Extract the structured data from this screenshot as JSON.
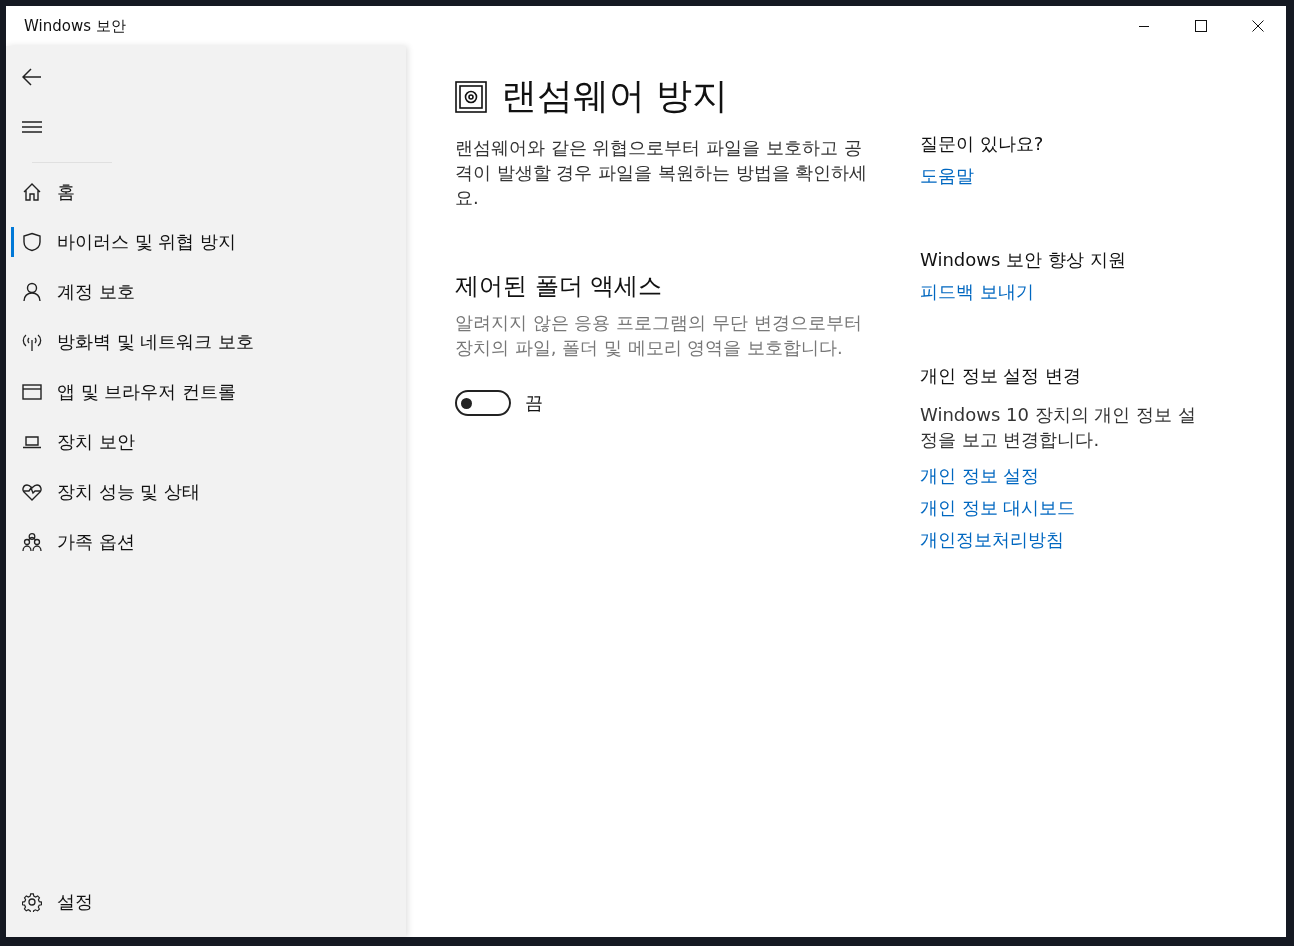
{
  "window": {
    "title": "Windows 보안"
  },
  "sidebar": {
    "items": [
      {
        "kind": "home",
        "label": "홈",
        "selected": false
      },
      {
        "kind": "shield",
        "label": "바이러스 및 위협 방지",
        "selected": true
      },
      {
        "kind": "person",
        "label": "계정 보호",
        "selected": false
      },
      {
        "kind": "antenna",
        "label": "방화벽 및 네트워크 보호",
        "selected": false
      },
      {
        "kind": "window",
        "label": "앱 및 브라우저 컨트롤",
        "selected": false
      },
      {
        "kind": "laptop",
        "label": "장치 보안",
        "selected": false
      },
      {
        "kind": "heart",
        "label": "장치 성능 및 상태",
        "selected": false
      },
      {
        "kind": "family",
        "label": "가족 옵션",
        "selected": false
      }
    ],
    "settings": {
      "label": "설정"
    }
  },
  "page": {
    "title": "랜섬웨어 방지",
    "description": "랜섬웨어와 같은 위협으로부터 파일을 보호하고 공격이 발생할 경우 파일을 복원하는 방법을 확인하세요.",
    "section": {
      "heading": "제어된 폴더 액세스",
      "description": "알려지지 않은 응용 프로그램의 무단 변경으로부터 장치의 파일, 폴더 및 메모리 영역을 보호합니다.",
      "toggle": {
        "on": false,
        "label": "끔"
      }
    }
  },
  "aside": [
    {
      "heading": "질문이 있나요?",
      "links": [
        "도움말"
      ]
    },
    {
      "heading": "Windows 보안 향상 지원",
      "links": [
        "피드백 보내기"
      ]
    },
    {
      "heading": "개인 정보 설정 변경",
      "text": "Windows 10 장치의 개인 정보 설정을 보고 변경합니다.",
      "links": [
        "개인 정보 설정",
        "개인 정보 대시보드",
        "개인정보처리방침"
      ]
    }
  ]
}
